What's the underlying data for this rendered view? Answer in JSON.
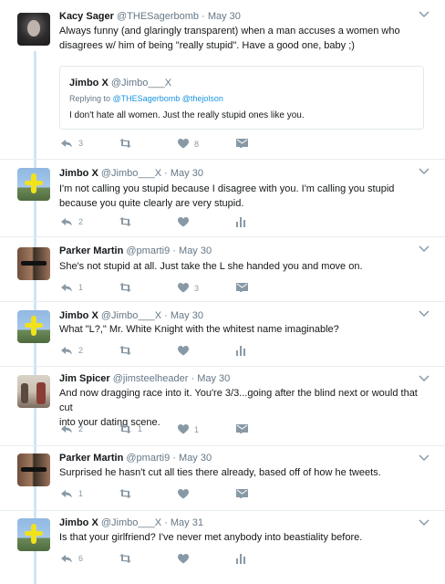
{
  "tweets": [
    {
      "name": "Kacy Sager",
      "handle": "@THESagerbomb",
      "dot": "·",
      "time": "May 30",
      "line1": "Always funny (and glaringly transparent) when a man accuses a women who",
      "line2": "disagrees w/ him of being \"really stupid\". Have a good one, baby ;)",
      "quote": {
        "name": "Jimbo X",
        "handle": "@Jimbo___X",
        "replying_prefix": "Replying to",
        "replying_to": "@THESagerbomb @thejolson",
        "text": "I don't hate all women. Just the really stupid ones like you."
      },
      "replies": "3",
      "retweets": "",
      "likes": "8"
    },
    {
      "name": "Jimbo X",
      "handle": "@Jimbo___X",
      "dot": "·",
      "time": "May 30",
      "line1": "I'm not calling you stupid because I disagree with you. I'm calling you stupid",
      "line2": "because you quite clearly are very stupid.",
      "replies": "2",
      "retweets": "",
      "likes": ""
    },
    {
      "name": "Parker Martin",
      "handle": "@pmarti9",
      "dot": "·",
      "time": "May 30",
      "line1": "She's not stupid at all. Just take the L she handed you and move on.",
      "replies": "1",
      "retweets": "",
      "likes": "3"
    },
    {
      "name": "Jimbo X",
      "handle": "@Jimbo___X",
      "dot": "·",
      "time": "May 30",
      "line1": "What \"L?,\" Mr. White Knight with the whitest name imaginable?",
      "replies": "2",
      "retweets": "",
      "likes": ""
    },
    {
      "name": "Jim Spicer",
      "handle": "@jimsteelheader",
      "dot": "·",
      "time": "May 30",
      "line1": "And now dragging race into it. You're 3/3...going after the blind next or would that cut",
      "line2": "into your dating scene.",
      "replies": "2",
      "retweets": "1",
      "likes": "1"
    },
    {
      "name": "Parker Martin",
      "handle": "@pmarti9",
      "dot": "·",
      "time": "May 30",
      "line1": "Surprised he hasn't cut all ties there already, based off of how he tweets.",
      "replies": "1",
      "retweets": "",
      "likes": ""
    },
    {
      "name": "Jimbo X",
      "handle": "@Jimbo___X",
      "dot": "·",
      "time": "May 31",
      "line1": "Is that your girlfriend? I've never met anybody into beastiality before.",
      "replies": "6",
      "retweets": "",
      "likes": ""
    }
  ],
  "icons": {
    "reply": "reply-icon",
    "retweet": "retweet-icon",
    "like": "heart-icon",
    "dm": "envelope-icon",
    "analytics": "analytics-icon",
    "caret": "chevron-down-icon"
  },
  "colors": {
    "thread_line": "#cfe6f6",
    "icon_gray": "#8899a6",
    "link_blue": "#1b95e0",
    "text": "#14171a",
    "meta": "#657786"
  }
}
